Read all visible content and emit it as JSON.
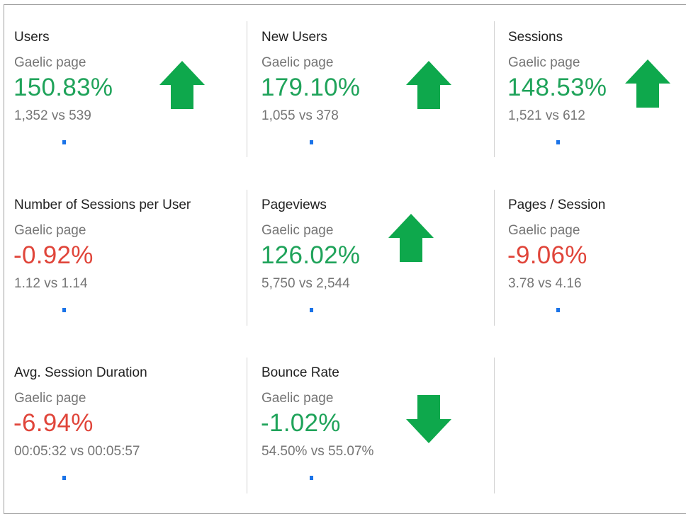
{
  "colors": {
    "positive": "#1fa35a",
    "negative": "#e0453a",
    "arrow": "#0ea84c",
    "sparkline_dot": "#1a73e8"
  },
  "metrics": [
    {
      "title": "Users",
      "segment": "Gaelic page",
      "change": "150.83%",
      "comparison": "1,352 vs 539",
      "trend": "good",
      "arrow": "up-arrow-icon"
    },
    {
      "title": "New Users",
      "segment": "Gaelic page",
      "change": "179.10%",
      "comparison": "1,055 vs 378",
      "trend": "good",
      "arrow": "up-arrow-icon"
    },
    {
      "title": "Sessions",
      "segment": "Gaelic page",
      "change": "148.53%",
      "comparison": "1,521 vs 612",
      "trend": "good",
      "arrow": "up-arrow-icon"
    },
    {
      "title": "Number of Sessions per User",
      "segment": "Gaelic page",
      "change": "-0.92%",
      "comparison": "1.12 vs 1.14",
      "trend": "bad",
      "arrow": null
    },
    {
      "title": "Pageviews",
      "segment": "Gaelic page",
      "change": "126.02%",
      "comparison": "5,750 vs 2,544",
      "trend": "good",
      "arrow": "up-arrow-icon"
    },
    {
      "title": "Pages / Session",
      "segment": "Gaelic page",
      "change": "-9.06%",
      "comparison": "3.78 vs 4.16",
      "trend": "bad",
      "arrow": null
    },
    {
      "title": "Avg. Session Duration",
      "segment": "Gaelic page",
      "change": "-6.94%",
      "comparison": "00:05:32 vs 00:05:57",
      "trend": "bad",
      "arrow": null
    },
    {
      "title": "Bounce Rate",
      "segment": "Gaelic page",
      "change": "-1.02%",
      "comparison": "54.50% vs 55.07%",
      "trend": "good",
      "arrow": "down-arrow-icon"
    }
  ]
}
